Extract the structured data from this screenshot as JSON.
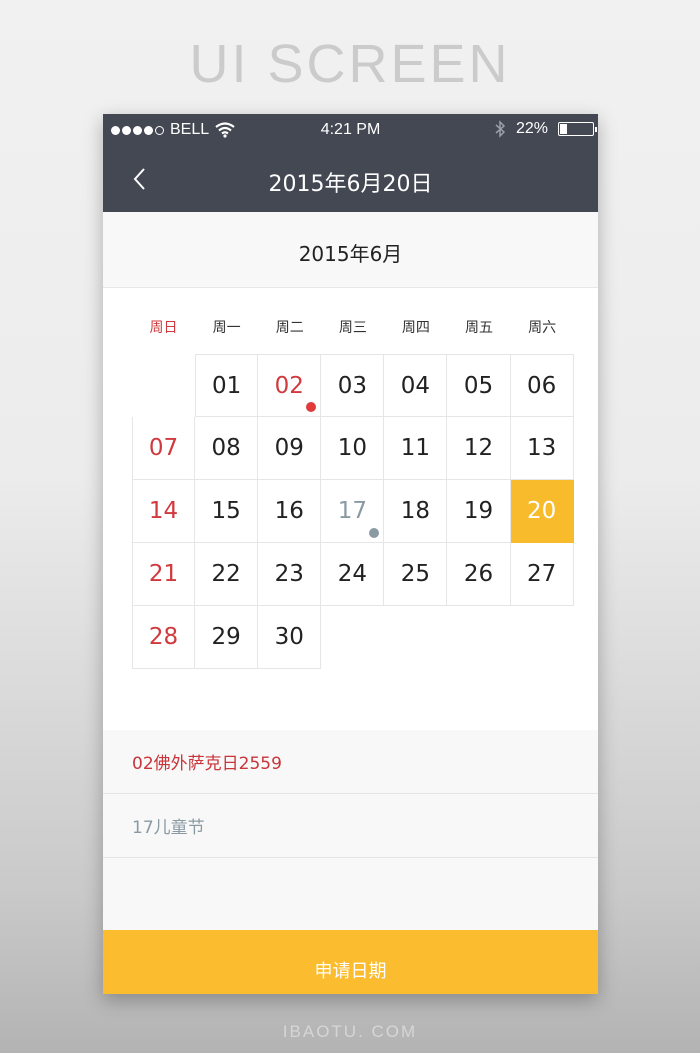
{
  "page": {
    "banner": "UI SCREEN",
    "footer_brand": "IBAOTU. COM"
  },
  "status_bar": {
    "signal_filled": 4,
    "signal_total": 5,
    "carrier": "BELL",
    "time": "4:21 PM",
    "battery_percent_label": "22%",
    "battery_level": 0.22,
    "icons": [
      "signal-dots",
      "wifi-icon",
      "bluetooth-icon",
      "battery-icon"
    ]
  },
  "navbar": {
    "back_icon": "chevron-left-icon",
    "title": "2015年6月20日"
  },
  "calendar": {
    "month_title": "2015年6月",
    "weekdays": [
      "周日",
      "周一",
      "周二",
      "周三",
      "周四",
      "周五",
      "周六"
    ],
    "weeks": [
      [
        null,
        "01",
        "02",
        "03",
        "04",
        "05",
        "06"
      ],
      [
        "07",
        "08",
        "09",
        "10",
        "11",
        "12",
        "13"
      ],
      [
        "14",
        "15",
        "16",
        "17",
        "18",
        "19",
        "20"
      ],
      [
        "21",
        "22",
        "23",
        "24",
        "25",
        "26",
        "27"
      ],
      [
        "28",
        "29",
        "30",
        null,
        null,
        null,
        null
      ]
    ],
    "selected_day": "20",
    "holidays": [
      {
        "day": "02",
        "style": "red",
        "marker_color": "#e03a3a"
      },
      {
        "day": "17",
        "style": "gray",
        "marker_color": "#8a9aa3"
      }
    ]
  },
  "events": [
    {
      "label": "02佛外萨克日2559",
      "style": "red"
    },
    {
      "label": "17儿童节",
      "style": "gray"
    }
  ],
  "apply_button": {
    "label": "申请日期"
  },
  "colors": {
    "header_bg": "#434852",
    "accent": "#fbbd2f",
    "sunday_red": "#d0393d",
    "holiday_gray": "#8a9aa3"
  }
}
